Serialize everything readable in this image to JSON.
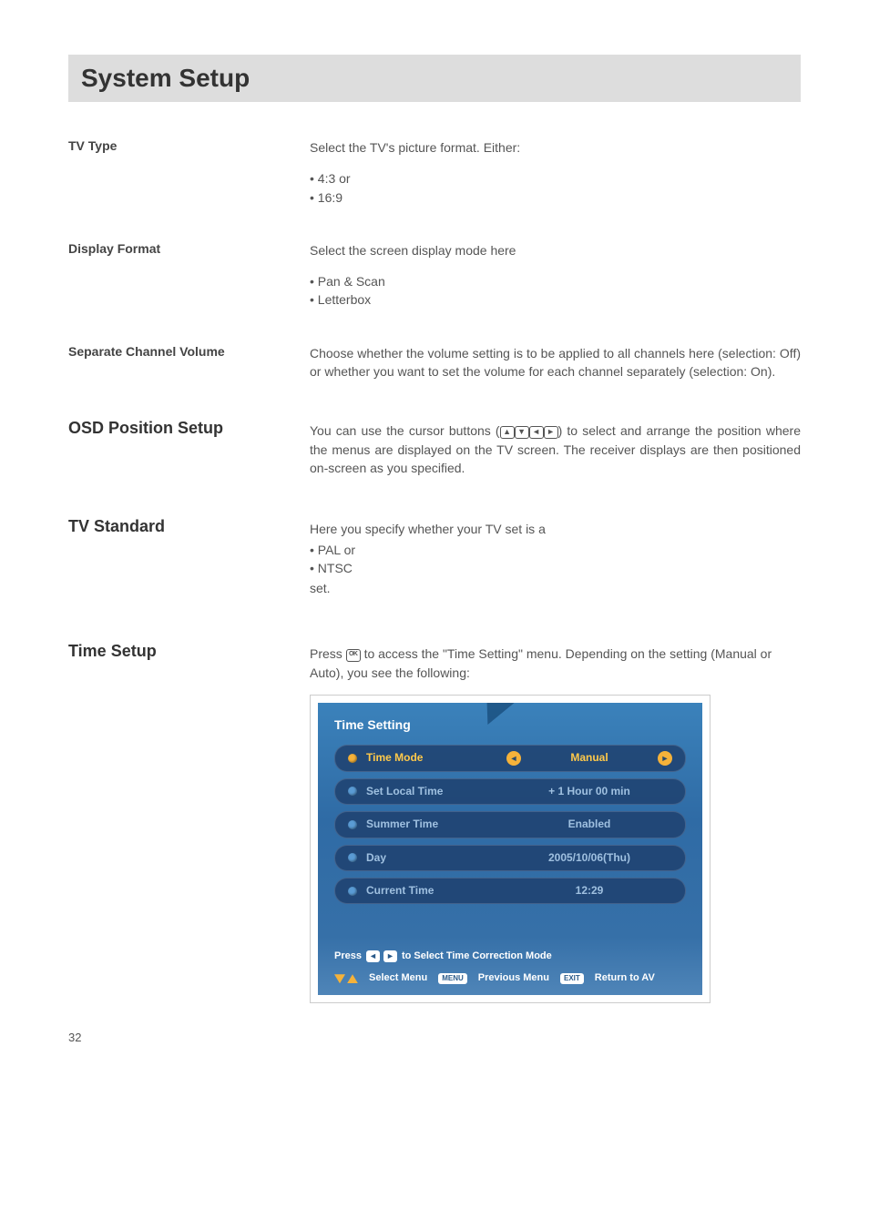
{
  "page": {
    "title": "System Setup",
    "pageNumber": "32"
  },
  "tvType": {
    "label": "TV Type",
    "intro": "Select the TV's picture format. Either:",
    "items": [
      "4:3 or",
      "16:9"
    ]
  },
  "displayFormat": {
    "label": "Display Format",
    "intro": "Select the screen display mode here",
    "items": [
      "Pan & Scan",
      "Letterbox"
    ]
  },
  "separateChannelVolume": {
    "label": "Separate Channel Volume",
    "text": "Choose whether the volume setting is to be applied to all channels here (selection: Off) or whether you want to set the volume for each channel separately (selection: On)."
  },
  "osdPosition": {
    "label": "OSD Position Setup",
    "pre": "You can use the cursor buttons (",
    "post": ") to select and arrange the position where the menus are displayed on the TV screen. The receiver displays are then positioned on-screen as you specified."
  },
  "tvStandard": {
    "label": "TV Standard",
    "intro": "Here you specify whether your TV set is a",
    "items": [
      "PAL or",
      "NTSC"
    ],
    "outro": "set."
  },
  "timeSetup": {
    "label": "Time Setup",
    "pre": "Press ",
    "post": " to access the \"Time Setting\" menu. Depending on the setting (Manual or Auto), you see the following:"
  },
  "screenshot": {
    "title": "Time Setting",
    "rows": [
      {
        "name": "Time Mode",
        "value": "Manual",
        "selected": true,
        "arrows": true
      },
      {
        "name": "Set Local Time",
        "value": "+ 1 Hour 00 min",
        "selected": false,
        "arrows": false
      },
      {
        "name": "Summer Time",
        "value": "Enabled",
        "selected": false,
        "arrows": false
      },
      {
        "name": "Day",
        "value": "2005/10/06(Thu)",
        "selected": false,
        "arrows": false
      },
      {
        "name": "Current Time",
        "value": "12:29",
        "selected": false,
        "arrows": false
      }
    ],
    "hint": {
      "pre": "Press ",
      "l": "◄",
      "r": "►",
      "post": " to Select Time Correction Mode"
    },
    "footer": {
      "selectMenu": "Select Menu",
      "menuBtn": "MENU",
      "previousMenu": "Previous Menu",
      "exitBtn": "EXIT",
      "returnAV": "Return to AV"
    }
  }
}
